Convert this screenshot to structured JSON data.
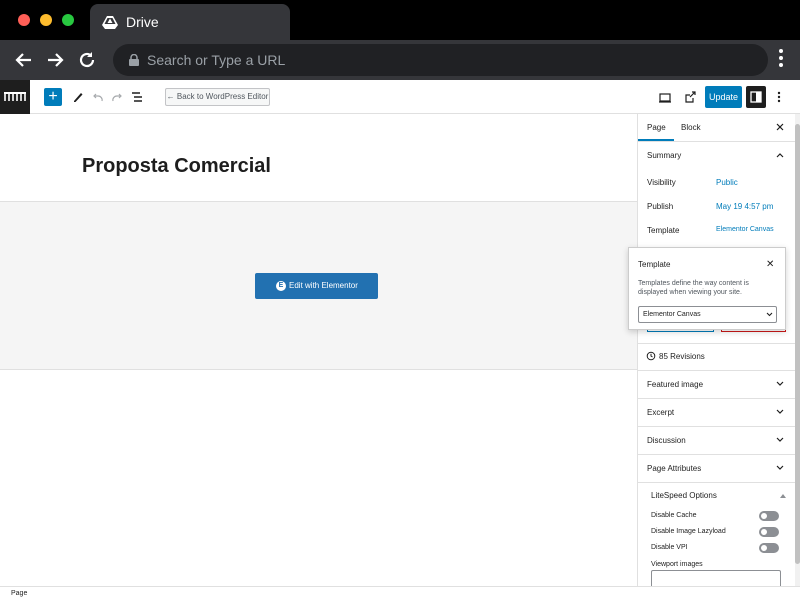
{
  "browser": {
    "tab_title": "Drive",
    "url_placeholder": "Search or Type a URL"
  },
  "editor_header": {
    "back_label": "← Back to WordPress Editor",
    "update_label": "Update"
  },
  "canvas": {
    "page_title": "Proposta Comercial",
    "edit_button_label": "Edit with Elementor"
  },
  "sidebar": {
    "tabs": [
      "Page",
      "Block"
    ],
    "summary_title": "Summary",
    "visibility_label": "Visibility",
    "visibility_value": "Public",
    "publish_label": "Publish",
    "publish_value": "May 19 4:57 pm",
    "template_label": "Template",
    "template_value": "Elementor Canvas",
    "revisions_label": "85 Revisions",
    "panels": [
      "Featured image",
      "Excerpt",
      "Discussion",
      "Page Attributes"
    ],
    "litespeed_title": "LiteSpeed Options",
    "options": [
      "Disable Cache",
      "Disable Image Lazyload",
      "Disable VPI"
    ],
    "viewport_label": "Viewport images"
  },
  "popover": {
    "title": "Template",
    "description": "Templates define the way content is displayed when viewing your site.",
    "select_value": "Elementor Canvas"
  },
  "statusbar": {
    "text": "Page"
  },
  "colors": {
    "accent": "#007cba",
    "elementor_blue": "#2271b1",
    "browser_dark": "#35363a"
  }
}
